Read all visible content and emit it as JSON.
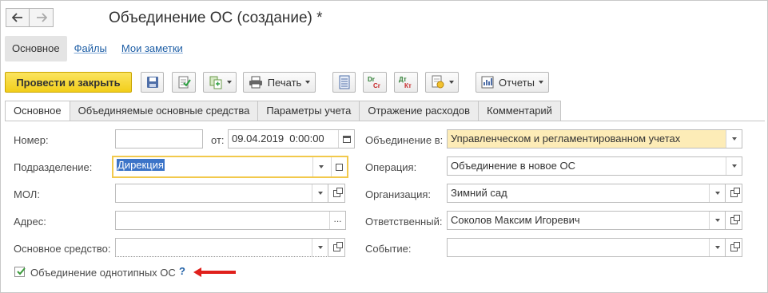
{
  "window": {
    "title": "Объединение ОС (создание) *"
  },
  "sections": [
    {
      "label": "Основное"
    },
    {
      "label": "Файлы"
    },
    {
      "label": "Мои заметки"
    }
  ],
  "toolbar": {
    "post_close_label": "Провести и закрыть",
    "print_label": "Печать",
    "reports_label": "Отчеты",
    "dr_cr_icon_text_top": "Dr",
    "dr_cr_icon_text_bottom": "Cr",
    "dt_kt_icon_text_top": "Дт",
    "dt_kt_icon_text_bottom": "Кт"
  },
  "tabs": [
    {
      "label": "Основное"
    },
    {
      "label": "Объединяемые основные средства"
    },
    {
      "label": "Параметры учета"
    },
    {
      "label": "Отражение расходов"
    },
    {
      "label": "Комментарий"
    }
  ],
  "form": {
    "number_label": "Номер:",
    "number_value": "",
    "from_label": "от:",
    "date_value": "09.04.2019  0:00:00",
    "department_label": "Подразделение:",
    "department_value": "Дирекция",
    "mol_label": "МОЛ:",
    "mol_value": "",
    "address_label": "Адрес:",
    "address_value": "",
    "asset_label": "Основное средство:",
    "asset_value": "",
    "merge_in_label": "Объединение в:",
    "merge_in_value": "Управленческом и регламентированном учетах",
    "operation_label": "Операция:",
    "operation_value": "Объединение в новое ОС",
    "organization_label": "Организация:",
    "organization_value": "Зимний сад",
    "responsible_label": "Ответственный:",
    "responsible_value": "Соколов Максим Игоревич",
    "event_label": "Событие:",
    "event_value": "",
    "same_type_label": "Объединение однотипных ОС",
    "same_type_checked": true,
    "help_mark": "?"
  },
  "colors": {
    "primary_button": "#f2ce1a",
    "link": "#1f5fa6",
    "focus_border": "#f2c94c",
    "highlight_field": "#fdecb7",
    "annotation_arrow": "#e0201c"
  }
}
